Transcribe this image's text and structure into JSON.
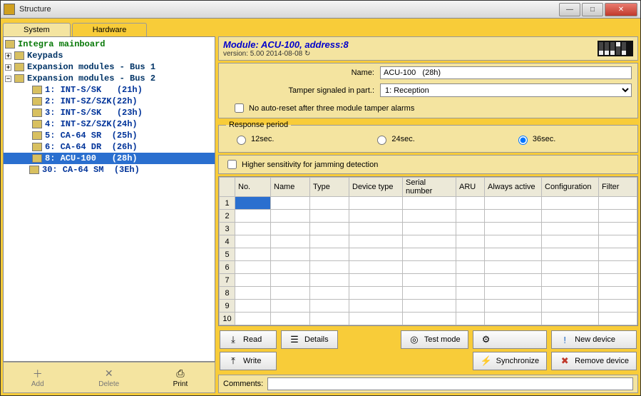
{
  "window": {
    "title": "Structure"
  },
  "tabs": {
    "system": "System",
    "hardware": "Hardware"
  },
  "tree": {
    "root": "Integra mainboard",
    "keypads": "Keypads",
    "bus1": "Expansion modules - Bus 1",
    "bus2": "Expansion modules - Bus 2",
    "items": [
      {
        "label": "1: INT-S/SK   (21h)"
      },
      {
        "label": "2: INT-SZ/SZK(22h)"
      },
      {
        "label": "3: INT-S/SK   (23h)"
      },
      {
        "label": "4: INT-SZ/SZK(24h)"
      },
      {
        "label": "5: CA-64 SR  (25h)"
      },
      {
        "label": "6: CA-64 DR  (26h)"
      },
      {
        "label": "8: ACU-100   (28h)",
        "selected": true
      },
      {
        "label": "30: CA-64 SM  (3Eh)"
      }
    ]
  },
  "toolbar": {
    "add": "Add",
    "delete": "Delete",
    "print": "Print"
  },
  "module": {
    "title": "Module: ACU-100, address:8",
    "version": "version: 5.00 2014-08-08",
    "name_label": "Name:",
    "name_value": "ACU-100   (28h)",
    "tamper_label": "Tamper signaled in part.:",
    "tamper_value": "1: Reception",
    "autoreset": "No auto-reset after three module tamper alarms",
    "response_legend": "Response period",
    "r12": "12sec.",
    "r24": "24sec.",
    "r36": "36sec.",
    "jamming": "Higher sensitivity for jamming detection"
  },
  "grid": {
    "headers": [
      "",
      "No.",
      "Name",
      "Type",
      "Device type",
      "Serial number",
      "ARU",
      "Always active",
      "Configuration",
      "Filter"
    ],
    "rows": [
      1,
      2,
      3,
      4,
      5,
      6,
      7,
      8,
      9,
      10
    ]
  },
  "buttons": {
    "read": "Read",
    "write": "Write",
    "details": "Details",
    "testmode": "Test mode",
    "sync": "Synchronize",
    "newdev": "New device",
    "removedev": "Remove device"
  },
  "comments": {
    "label": "Comments:",
    "value": ""
  }
}
